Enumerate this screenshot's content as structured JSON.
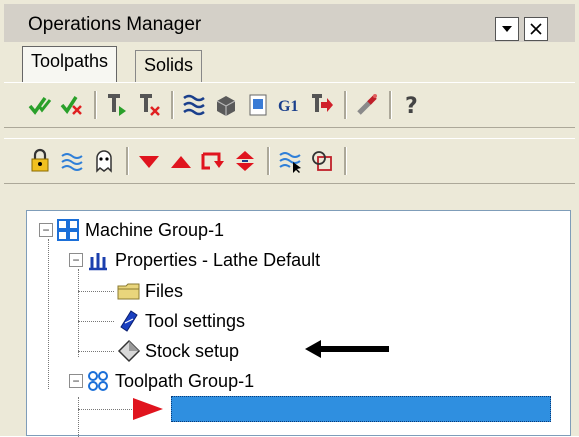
{
  "window": {
    "title": "Operations Manager"
  },
  "titlebar_buttons": {
    "dropdown_icon": "chevron-down-icon",
    "close_icon": "close-icon"
  },
  "tabs": [
    {
      "label": "Toolpaths",
      "active": true
    },
    {
      "label": "Solids",
      "active": false
    }
  ],
  "toolbar1": [
    "select-all-icon",
    "deselect-icon",
    "regenerate-icon",
    "regenerate-dirty-icon",
    "backplot-icon",
    "verify-icon",
    "simulate-icon",
    "post-g1-icon",
    "post-selected-icon",
    "highfeed-icon",
    "help-icon"
  ],
  "toolbar2": [
    "lock-icon",
    "toggle-display-icon",
    "toggle-posting-icon",
    "move-down-icon",
    "move-up-icon",
    "insert-arrow-icon",
    "scroll-icon",
    "only-selected-icon",
    "shading-icon"
  ],
  "tree": {
    "machine_group": "Machine Group-1",
    "properties": "Properties - Lathe Default",
    "files": "Files",
    "tool_settings": "Tool settings",
    "stock_setup": "Stock setup",
    "toolpath_group": "Toolpath Group-1"
  },
  "colors": {
    "accent": "#2f8fe0",
    "insert_arrow": "#e0141e"
  }
}
